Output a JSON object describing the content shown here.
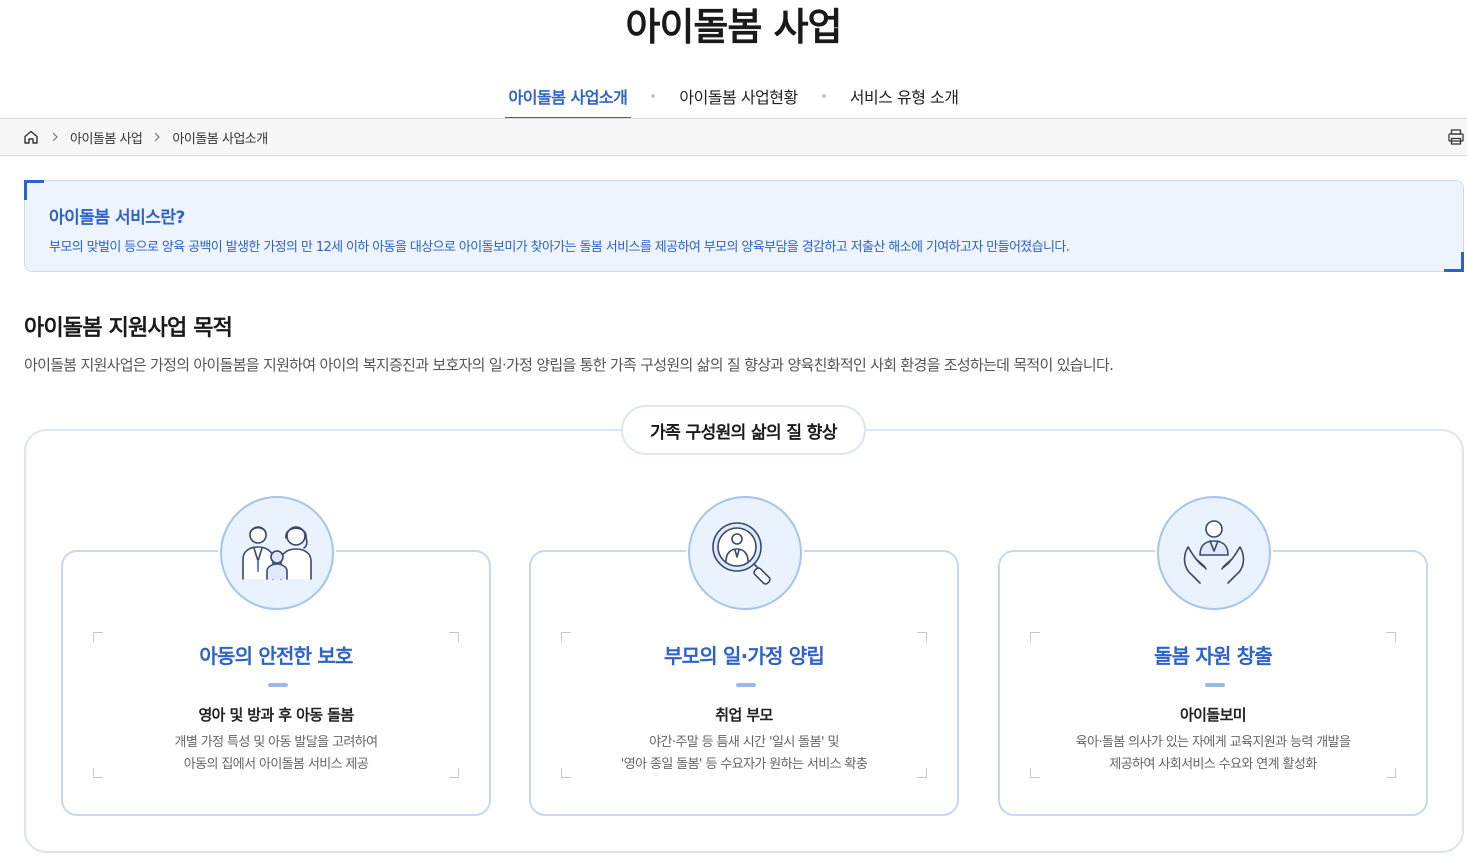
{
  "page": {
    "title": "아이돌봄 사업"
  },
  "tabs": [
    {
      "label": "아이돌봄 사업소개",
      "active": true
    },
    {
      "label": "아이돌봄 사업현황",
      "active": false
    },
    {
      "label": "서비스 유형 소개",
      "active": false
    }
  ],
  "breadcrumb": {
    "items": [
      "아이돌봄 사업",
      "아이돌봄 사업소개"
    ]
  },
  "info": {
    "title": "아이돌봄 서비스란?",
    "description": "부모의 맞벌이 등으로 양육 공백이 발생한 가정의 만 12세 이하 아동을 대상으로 아이돌보미가 찾아가는 돌봄 서비스를 제공하여 부모의 양육부담을 경감하고 저출산 해소에 기여하고자 만들어졌습니다."
  },
  "section": {
    "title": "아이돌봄 지원사업 목적",
    "description": "아이돌봄 지원사업은 가정의 아이돌봄을 지원하여 아이의 복지증진과 보호자의 일·가정 양립을 통한 가족 구성원의 삶의 질 향상과 양육친화적인 사회 환경을 조성하는데 목적이 있습니다."
  },
  "goal": {
    "label": "가족 구성원의 삶의 질 향상",
    "cards": [
      {
        "icon": "family-icon",
        "title": "아동의 안전한 보호",
        "subtitle": "영아 및 방과 후 아동 돌봄",
        "desc_line1": "개별 가정 특성 및 아동 발달을 고려하여",
        "desc_line2": "아동의 집에서 아이돌봄 서비스 제공"
      },
      {
        "icon": "magnifier-person-icon",
        "title": "부모의 일·가정 양립",
        "subtitle": "취업 부모",
        "desc_line1": "야간·주말 등 틈새 시간 '일시 돌봄' 및",
        "desc_line2": "'영아 종일 돌봄' 등 수요자가 원하는 서비스 확충"
      },
      {
        "icon": "caring-hands-icon",
        "title": "돌봄 자원 창출",
        "subtitle": "아이돌보미",
        "desc_line1": "육아·돌봄 의사가 있는 자에게 교육지원과 능력 개발을",
        "desc_line2": "제공하여 사회서비스 수요와 연계 활성화"
      }
    ]
  },
  "colors": {
    "accent": "#2d63c8",
    "info_bg": "#eef4fd",
    "card_border": "#c6d8f3",
    "icon_bg": "#eaf2fe"
  }
}
